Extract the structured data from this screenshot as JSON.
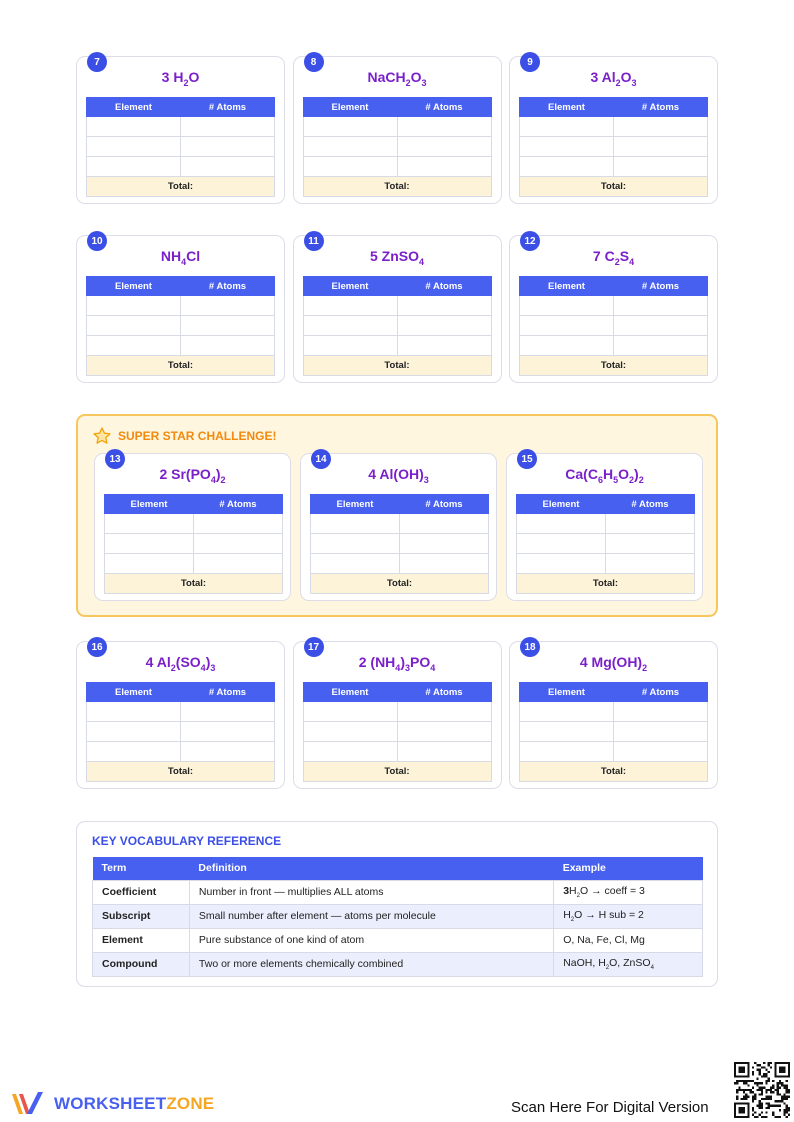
{
  "table_headers": {
    "element": "Element",
    "atoms": "# Atoms",
    "total": "Total:"
  },
  "rows": [
    [
      {
        "num": "7",
        "formula": [
          {
            "t": "3 H"
          },
          {
            "s": "2"
          },
          {
            "t": "O"
          }
        ]
      },
      {
        "num": "8",
        "formula": [
          {
            "t": "NaCH"
          },
          {
            "s": "2"
          },
          {
            "t": "O"
          },
          {
            "s": "3"
          }
        ]
      },
      {
        "num": "9",
        "formula": [
          {
            "t": "3 Al"
          },
          {
            "s": "2"
          },
          {
            "t": "O"
          },
          {
            "s": "3"
          }
        ]
      }
    ],
    [
      {
        "num": "10",
        "formula": [
          {
            "t": "NH"
          },
          {
            "s": "4"
          },
          {
            "t": "Cl"
          }
        ]
      },
      {
        "num": "11",
        "formula": [
          {
            "t": "5 ZnSO"
          },
          {
            "s": "4"
          }
        ]
      },
      {
        "num": "12",
        "formula": [
          {
            "t": "7 C"
          },
          {
            "s": "2"
          },
          {
            "t": "S"
          },
          {
            "s": "4"
          }
        ]
      }
    ]
  ],
  "challenge": {
    "title": "SUPER STAR CHALLENGE!",
    "cards": [
      {
        "num": "13",
        "formula": [
          {
            "t": "2 Sr(PO"
          },
          {
            "s": "4"
          },
          {
            "t": ")"
          },
          {
            "s": "2"
          }
        ]
      },
      {
        "num": "14",
        "formula": [
          {
            "t": "4 Al(OH)"
          },
          {
            "s": "3"
          }
        ]
      },
      {
        "num": "15",
        "formula": [
          {
            "t": "Ca(C"
          },
          {
            "s": "6"
          },
          {
            "t": "H"
          },
          {
            "s": "5"
          },
          {
            "t": "O"
          },
          {
            "s": "2"
          },
          {
            "t": ")"
          },
          {
            "s": "2"
          }
        ]
      }
    ]
  },
  "row4": [
    {
      "num": "16",
      "formula": [
        {
          "t": "4 Al"
        },
        {
          "s": "2"
        },
        {
          "t": "(SO"
        },
        {
          "s": "4"
        },
        {
          "t": ")"
        },
        {
          "s": "3"
        }
      ]
    },
    {
      "num": "17",
      "formula": [
        {
          "t": "2 (NH"
        },
        {
          "s": "4"
        },
        {
          "t": ")"
        },
        {
          "s": "3"
        },
        {
          "t": "PO"
        },
        {
          "s": "4"
        }
      ]
    },
    {
      "num": "18",
      "formula": [
        {
          "t": "4 Mg(OH)"
        },
        {
          "s": "2"
        }
      ]
    }
  ],
  "vocab": {
    "title": "KEY VOCABULARY REFERENCE",
    "headers": [
      "Term",
      "Definition",
      "Example"
    ],
    "rows": [
      {
        "term": "Coefficient",
        "definition": "Number in front — multiplies ALL atoms",
        "example": [
          {
            "b": "3"
          },
          {
            "t": "H"
          },
          {
            "s": "2"
          },
          {
            "t": "O → coeff = 3"
          }
        ]
      },
      {
        "term": "Subscript",
        "definition": "Small number after element — atoms per molecule",
        "example": [
          {
            "t": "H"
          },
          {
            "s": "2"
          },
          {
            "t": "O → H sub = 2"
          }
        ]
      },
      {
        "term": "Element",
        "definition": "Pure substance of one kind of atom",
        "example": [
          {
            "t": "O, Na, Fe, Cl, Mg"
          }
        ]
      },
      {
        "term": "Compound",
        "definition": "Two or more elements chemically combined",
        "example": [
          {
            "t": "NaOH, H"
          },
          {
            "s": "2"
          },
          {
            "t": "O, ZnSO"
          },
          {
            "s": "4"
          }
        ]
      }
    ]
  },
  "footer": {
    "logo_part1": "WORKSHEET",
    "logo_part2": "ZONE",
    "scan_text": "Scan Here For Digital Version",
    "colors": {
      "blue": "#4760f0",
      "orange": "#f5a623",
      "purple": "#7a1fc9"
    }
  }
}
